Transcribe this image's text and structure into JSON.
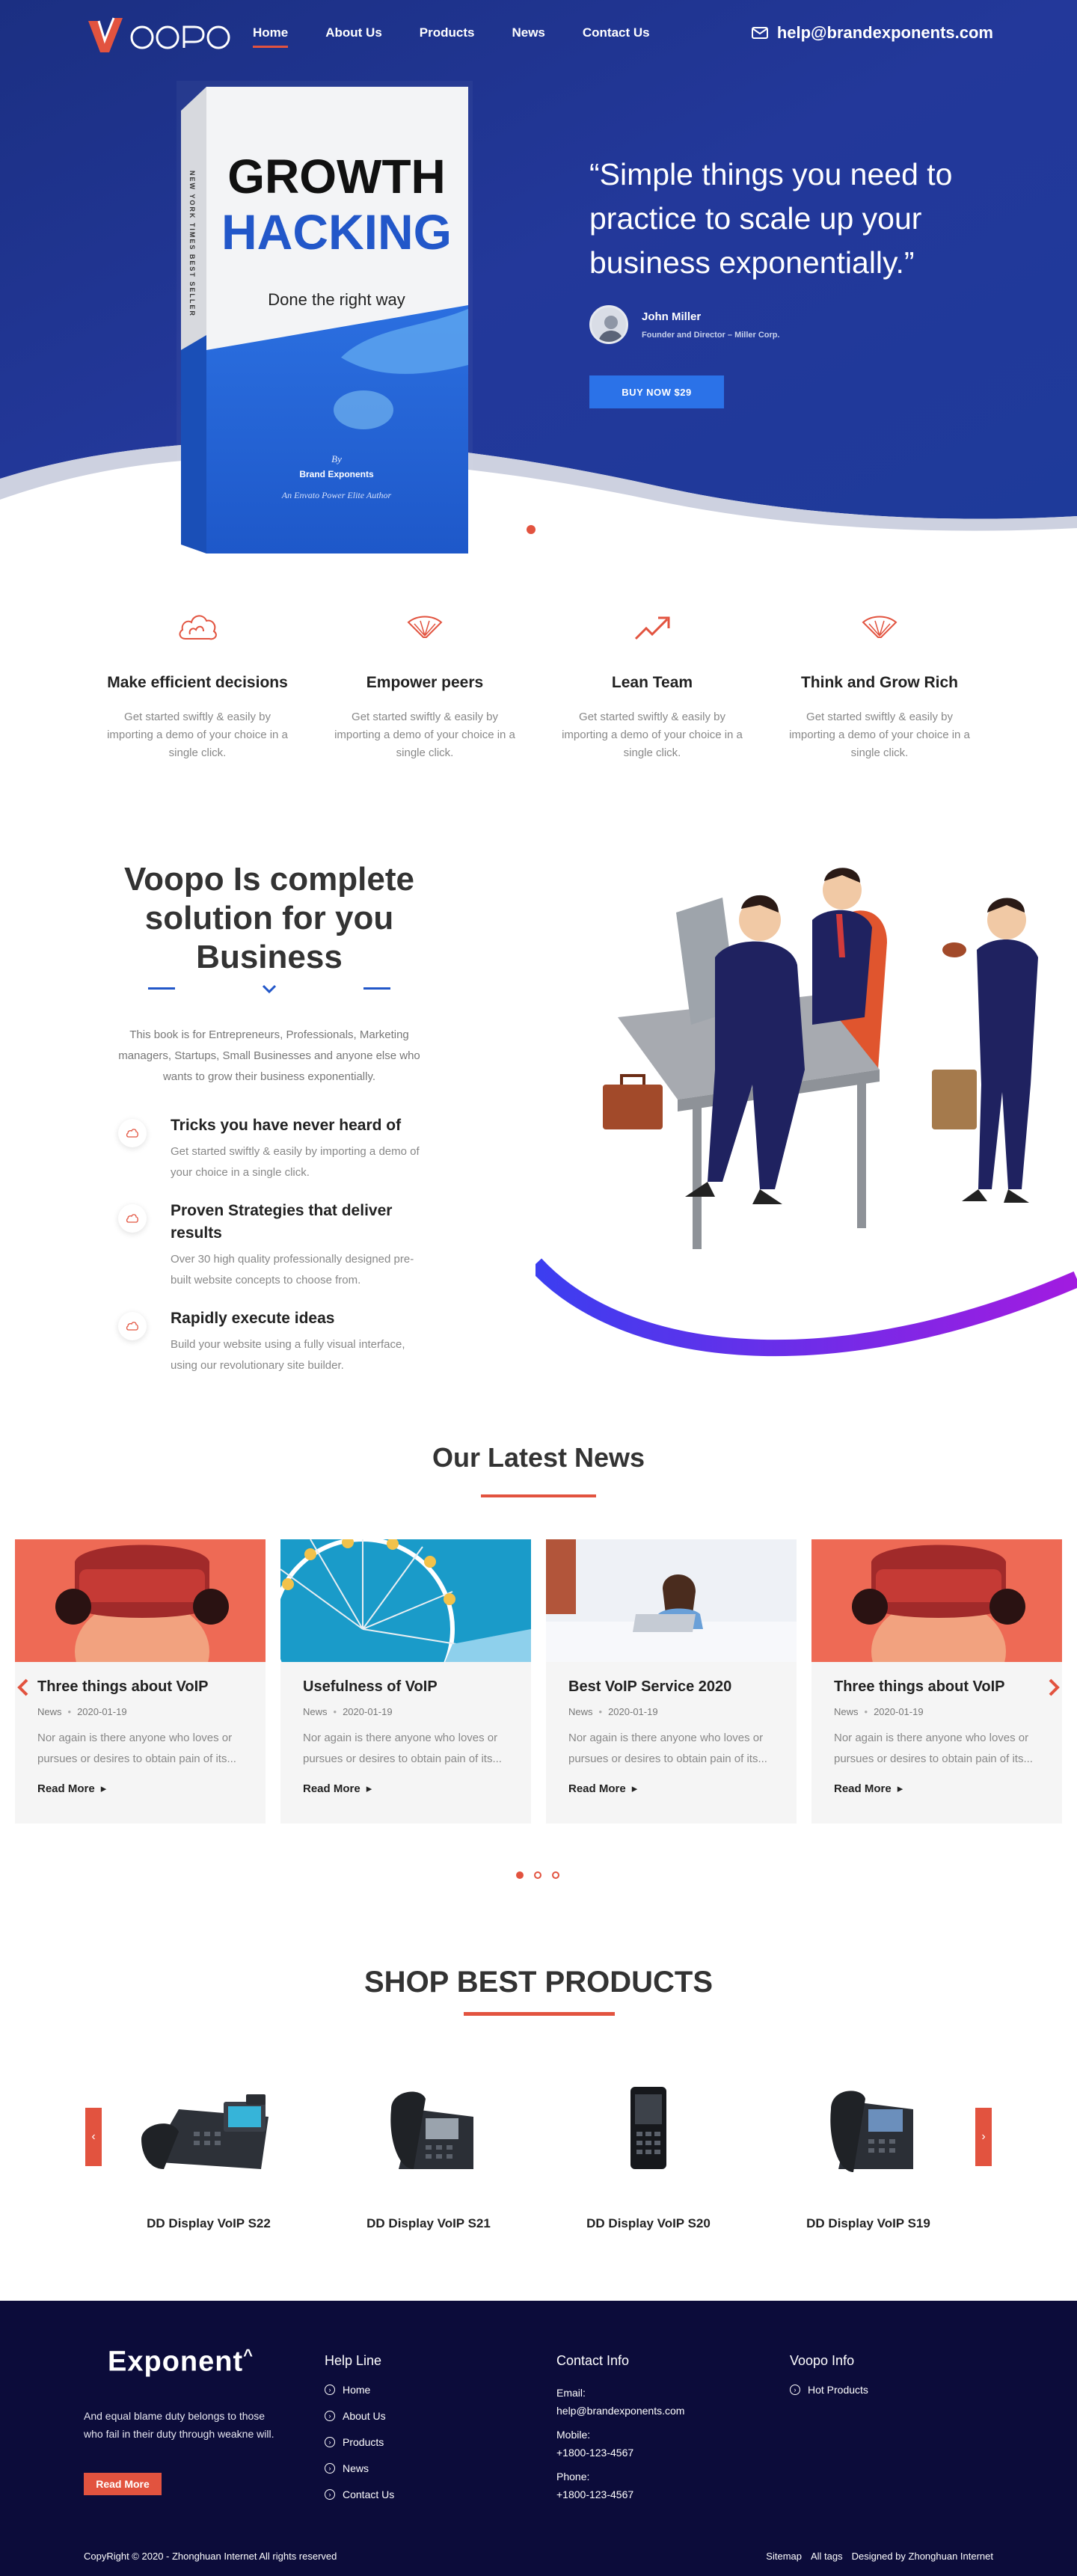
{
  "colors": {
    "brand_blue": "#1e3a8a",
    "accent": "#e2533f",
    "button_blue": "#2b72e8",
    "footer_bg": "#0c0c3a"
  },
  "nav": {
    "logo_text": "VOOPO",
    "links": [
      "Home",
      "About Us",
      "Products",
      "News",
      "Contact Us"
    ],
    "active": "Home",
    "email": "help@brandexponents.com",
    "email_icon": "envelope-icon"
  },
  "hero": {
    "book": {
      "title_line1": "GROWTH",
      "title_line2": "HACKING",
      "subtitle": "Done the right way",
      "spine": "NEW YORK TIMES BEST SELLER",
      "by": "By",
      "author": "Brand Exponents",
      "tagline": "An Envato Power Elite Author"
    },
    "quote": "“Simple things you need to practice to scale up your business exponentially.”",
    "author_name": "John Miller",
    "author_role": "Founder and Director – Miller Corp.",
    "button": "BUY NOW $29"
  },
  "features": [
    {
      "icon": "cloud-icon",
      "title": "Make efficient decisions",
      "text": "Get started swiftly & easily by importing a demo of your choice in a single click."
    },
    {
      "icon": "fan-icon",
      "title": "Empower peers",
      "text": "Get started swiftly & easily by importing a demo of your choice in a single click."
    },
    {
      "icon": "trend-up-icon",
      "title": "Lean Team",
      "text": "Get started swiftly & easily by importing a demo of your choice in a single click."
    },
    {
      "icon": "fan-icon",
      "title": "Think and Grow Rich",
      "text": "Get started swiftly & easily by importing a demo of your choice in a single click."
    }
  ],
  "about": {
    "title": "Voopo Is complete solution for you Business",
    "description": "This book is for Entrepreneurs, Professionals, Marketing managers, Startups, Small Businesses and anyone else who wants to grow their business exponentially.",
    "items": [
      {
        "icon": "cloud-icon",
        "title": "Tricks you have never heard of",
        "text": "Get started swiftly & easily by importing a demo of your choice in a single click."
      },
      {
        "icon": "cloud-icon",
        "title": "Proven Strategies that deliver results",
        "text": "Over 30 high quality professionally designed pre-built website concepts to choose from."
      },
      {
        "icon": "cloud-icon",
        "title": "Rapidly execute ideas",
        "text": "Build your website using a fully visual interface, using our revolutionary site builder."
      }
    ]
  },
  "news": {
    "title": "Our Latest News",
    "cards": [
      {
        "image": "vr-headset",
        "title": "Three things about VoIP",
        "category": "News",
        "date": "2020-01-19",
        "excerpt": "Nor again is there anyone who loves or pursues or desires to obtain pain of its...",
        "more": "Read More"
      },
      {
        "image": "ferris-wheel",
        "title": "Usefulness of VoIP",
        "category": "News",
        "date": "2020-01-19",
        "excerpt": "Nor again is there anyone who loves or pursues or desires to obtain pain of its...",
        "more": "Read More"
      },
      {
        "image": "woman-laptop",
        "title": "Best VoIP Service 2020",
        "category": "News",
        "date": "2020-01-19",
        "excerpt": "Nor again is there anyone who loves or pursues or desires to obtain pain of its...",
        "more": "Read More"
      },
      {
        "image": "vr-headset",
        "title": "Three things about VoIP",
        "category": "News",
        "date": "2020-01-19",
        "excerpt": "Nor again is there anyone who loves or pursues or desires to obtain pain of its...",
        "more": "Read More"
      }
    ],
    "pages": 3,
    "active_page": 1
  },
  "shop": {
    "title": "SHOP BEST PRODUCTS",
    "products": [
      {
        "name": "DD Display VoIP S22",
        "icon": "desk-phone-icon"
      },
      {
        "name": "DD Display VoIP S21",
        "icon": "desk-phone-icon"
      },
      {
        "name": "DD Display VoIP S20",
        "icon": "mobile-phone-icon"
      },
      {
        "name": "DD Display VoIP S19",
        "icon": "desk-phone-icon"
      }
    ]
  },
  "footer": {
    "logo": "Exponent",
    "logo_mark": "^",
    "about": "And equal blame duty belongs to those who fail in their duty through weakne will.",
    "button": "Read More",
    "help_title": "Help Line",
    "help_links": [
      "Home",
      "About Us",
      "Products",
      "News",
      "Contact Us"
    ],
    "contact_title": "Contact Info",
    "email_label": "Email:",
    "email": "help@brandexponents.com",
    "mobile_label": "Mobile:",
    "mobile": "+1800-123-4567",
    "phone_label": "Phone:",
    "phone": "+1800-123-4567",
    "info_title": "Voopo Info",
    "info_links": [
      "Hot Products"
    ],
    "copyright": "CopyRight © 2020 -   Zhonghuan Internet  All rights reserved",
    "bottom_links": [
      "Sitemap",
      "All tags",
      "Designed by Zhonghuan Internet"
    ]
  }
}
